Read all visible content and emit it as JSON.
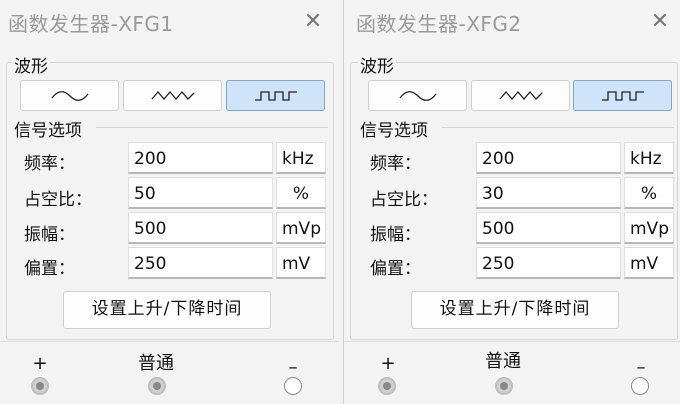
{
  "generators": [
    {
      "title": "函数发生器-XFG1",
      "close": "✕",
      "waveform_label": "波形",
      "waveforms": [
        "sine-wave-icon",
        "triangle-wave-icon",
        "square-wave-icon"
      ],
      "selected_waveform": "square",
      "signal_label": "信号选项",
      "frequency": {
        "label": "频率：",
        "value": "200",
        "unit": "kHz"
      },
      "duty_cycle": {
        "label": "占空比：",
        "value": "50",
        "unit": "%"
      },
      "amplitude": {
        "label": "振幅：",
        "value": "500",
        "unit": "mVp"
      },
      "offset": {
        "label": "偏置：",
        "value": "250",
        "unit": "mV"
      },
      "rise_fall_button": "设置上升/下降时间",
      "terminals": {
        "plus": "+",
        "common": "普通",
        "minus": "–"
      }
    },
    {
      "title": "函数发生器-XFG2",
      "close": "✕",
      "waveform_label": "波形",
      "waveforms": [
        "sine-wave-icon",
        "triangle-wave-icon",
        "square-wave-icon"
      ],
      "selected_waveform": "square",
      "signal_label": "信号选项",
      "frequency": {
        "label": "频率：",
        "value": "200",
        "unit": "kHz"
      },
      "duty_cycle": {
        "label": "占空比：",
        "value": "30",
        "unit": "%"
      },
      "amplitude": {
        "label": "振幅：",
        "value": "500",
        "unit": "mVp"
      },
      "offset": {
        "label": "偏置：",
        "value": "250",
        "unit": "mV"
      },
      "rise_fall_button": "设置上升/下降时间",
      "terminals": {
        "plus": "+",
        "common": "普通",
        "minus": "–"
      }
    }
  ],
  "colors": {
    "selected_button": "#cfe4f8",
    "selected_border": "#7aa6cf",
    "panel_bg": "#f3f3f3"
  }
}
